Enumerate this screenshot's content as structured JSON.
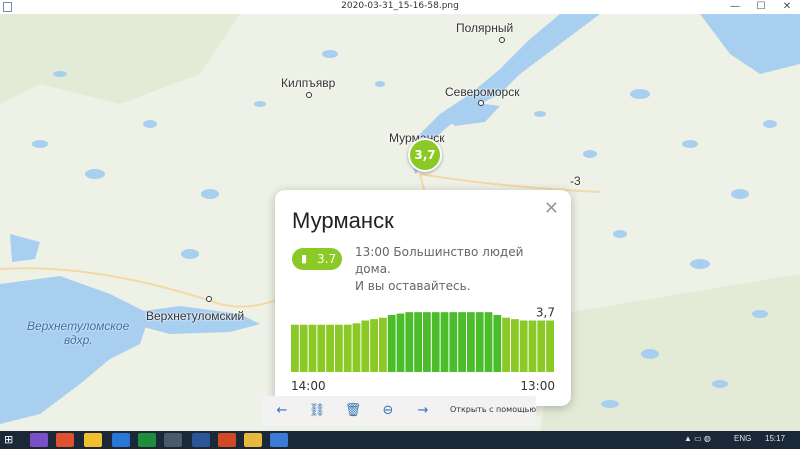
{
  "window": {
    "title": "2020-03-31_15-16-58.png"
  },
  "map": {
    "cities": [
      {
        "name": "Полярный"
      },
      {
        "name": "Килпъявр"
      },
      {
        "name": "Североморск"
      },
      {
        "name": "Мурманск"
      },
      {
        "name": "Верхнетуломский"
      },
      {
        "name": "-3"
      }
    ],
    "lake_label_line1": "Верхнетуломское",
    "lake_label_line2": "вдхр.",
    "pin_value": "3,7",
    "colors": {
      "land": "#eef2e6",
      "water": "#a9cff0",
      "forest": "#dce8cf",
      "accent": "#8ac926"
    }
  },
  "card": {
    "title": "Мурманск",
    "badge_value": "3.7",
    "badge_icon": "person-icon",
    "message_line1": "13:00 Большинство людей дома.",
    "message_line2": "И вы оставайтесь.",
    "close_icon": "close-icon"
  },
  "chart_data": {
    "type": "bar",
    "x_start_label": "14:00",
    "x_end_label": "13:00",
    "last_value_label": "3,7",
    "values": [
      3.4,
      3.4,
      3.4,
      3.4,
      3.4,
      3.4,
      3.4,
      3.5,
      3.7,
      3.8,
      3.9,
      4.1,
      4.2,
      4.3,
      4.3,
      4.3,
      4.3,
      4.3,
      4.3,
      4.3,
      4.3,
      4.3,
      4.3,
      4.1,
      3.9,
      3.8,
      3.7,
      3.7,
      3.7,
      3.7
    ],
    "ylim": [
      0,
      4.6
    ],
    "color_low": "#8ac926",
    "color_high": "#4bbd2a"
  },
  "toolbar": {
    "icons": [
      "back-arrow-icon",
      "link-icon",
      "trash-icon",
      "zoom-out-icon",
      "forward-arrow-icon"
    ],
    "open_with_label": "Открыть с помощью"
  },
  "taskbar": {
    "language": "ENG",
    "time": "15:17"
  }
}
